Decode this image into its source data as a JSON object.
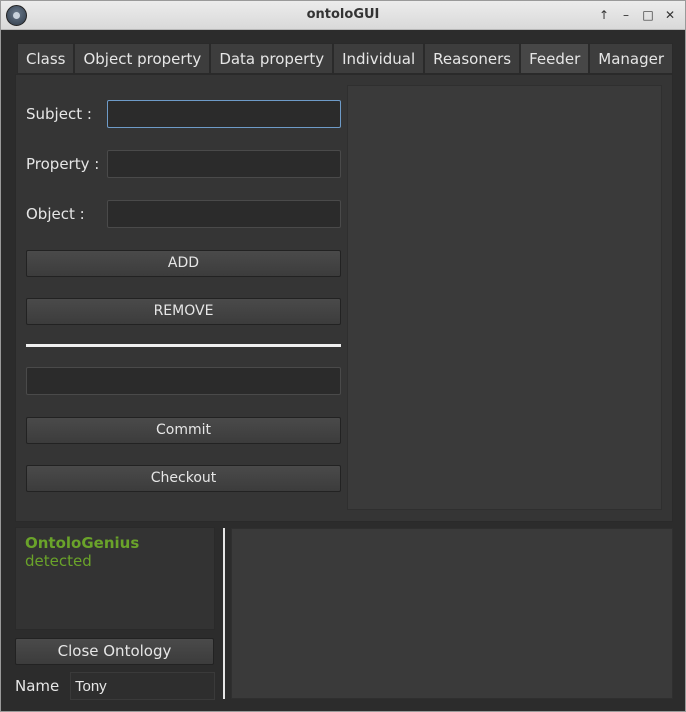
{
  "window": {
    "title": "ontoloGUI",
    "controls": [
      "↑",
      "–",
      "□",
      "✕"
    ]
  },
  "tabs": [
    {
      "label": "Class"
    },
    {
      "label": "Object property"
    },
    {
      "label": "Data property"
    },
    {
      "label": "Individual"
    },
    {
      "label": "Reasoners"
    },
    {
      "label": "Feeder",
      "active": true
    },
    {
      "label": "Manager"
    }
  ],
  "feeder": {
    "subject_label": "Subject :",
    "subject_value": "",
    "property_label": "Property :",
    "property_value": "",
    "object_label": "Object :",
    "object_value": "",
    "add_label": "ADD",
    "remove_label": "REMOVE",
    "commit_field_value": "",
    "commit_label": "Commit",
    "checkout_label": "Checkout"
  },
  "status": {
    "name": "OntoloGenius",
    "text": "detected"
  },
  "bottom": {
    "close_label": "Close Ontology",
    "name_label": "Name",
    "name_value": "Tony"
  },
  "colors": {
    "status_green": "#6aa32a",
    "focus_border": "#6e9bc8",
    "background": "#2c2c2c"
  }
}
